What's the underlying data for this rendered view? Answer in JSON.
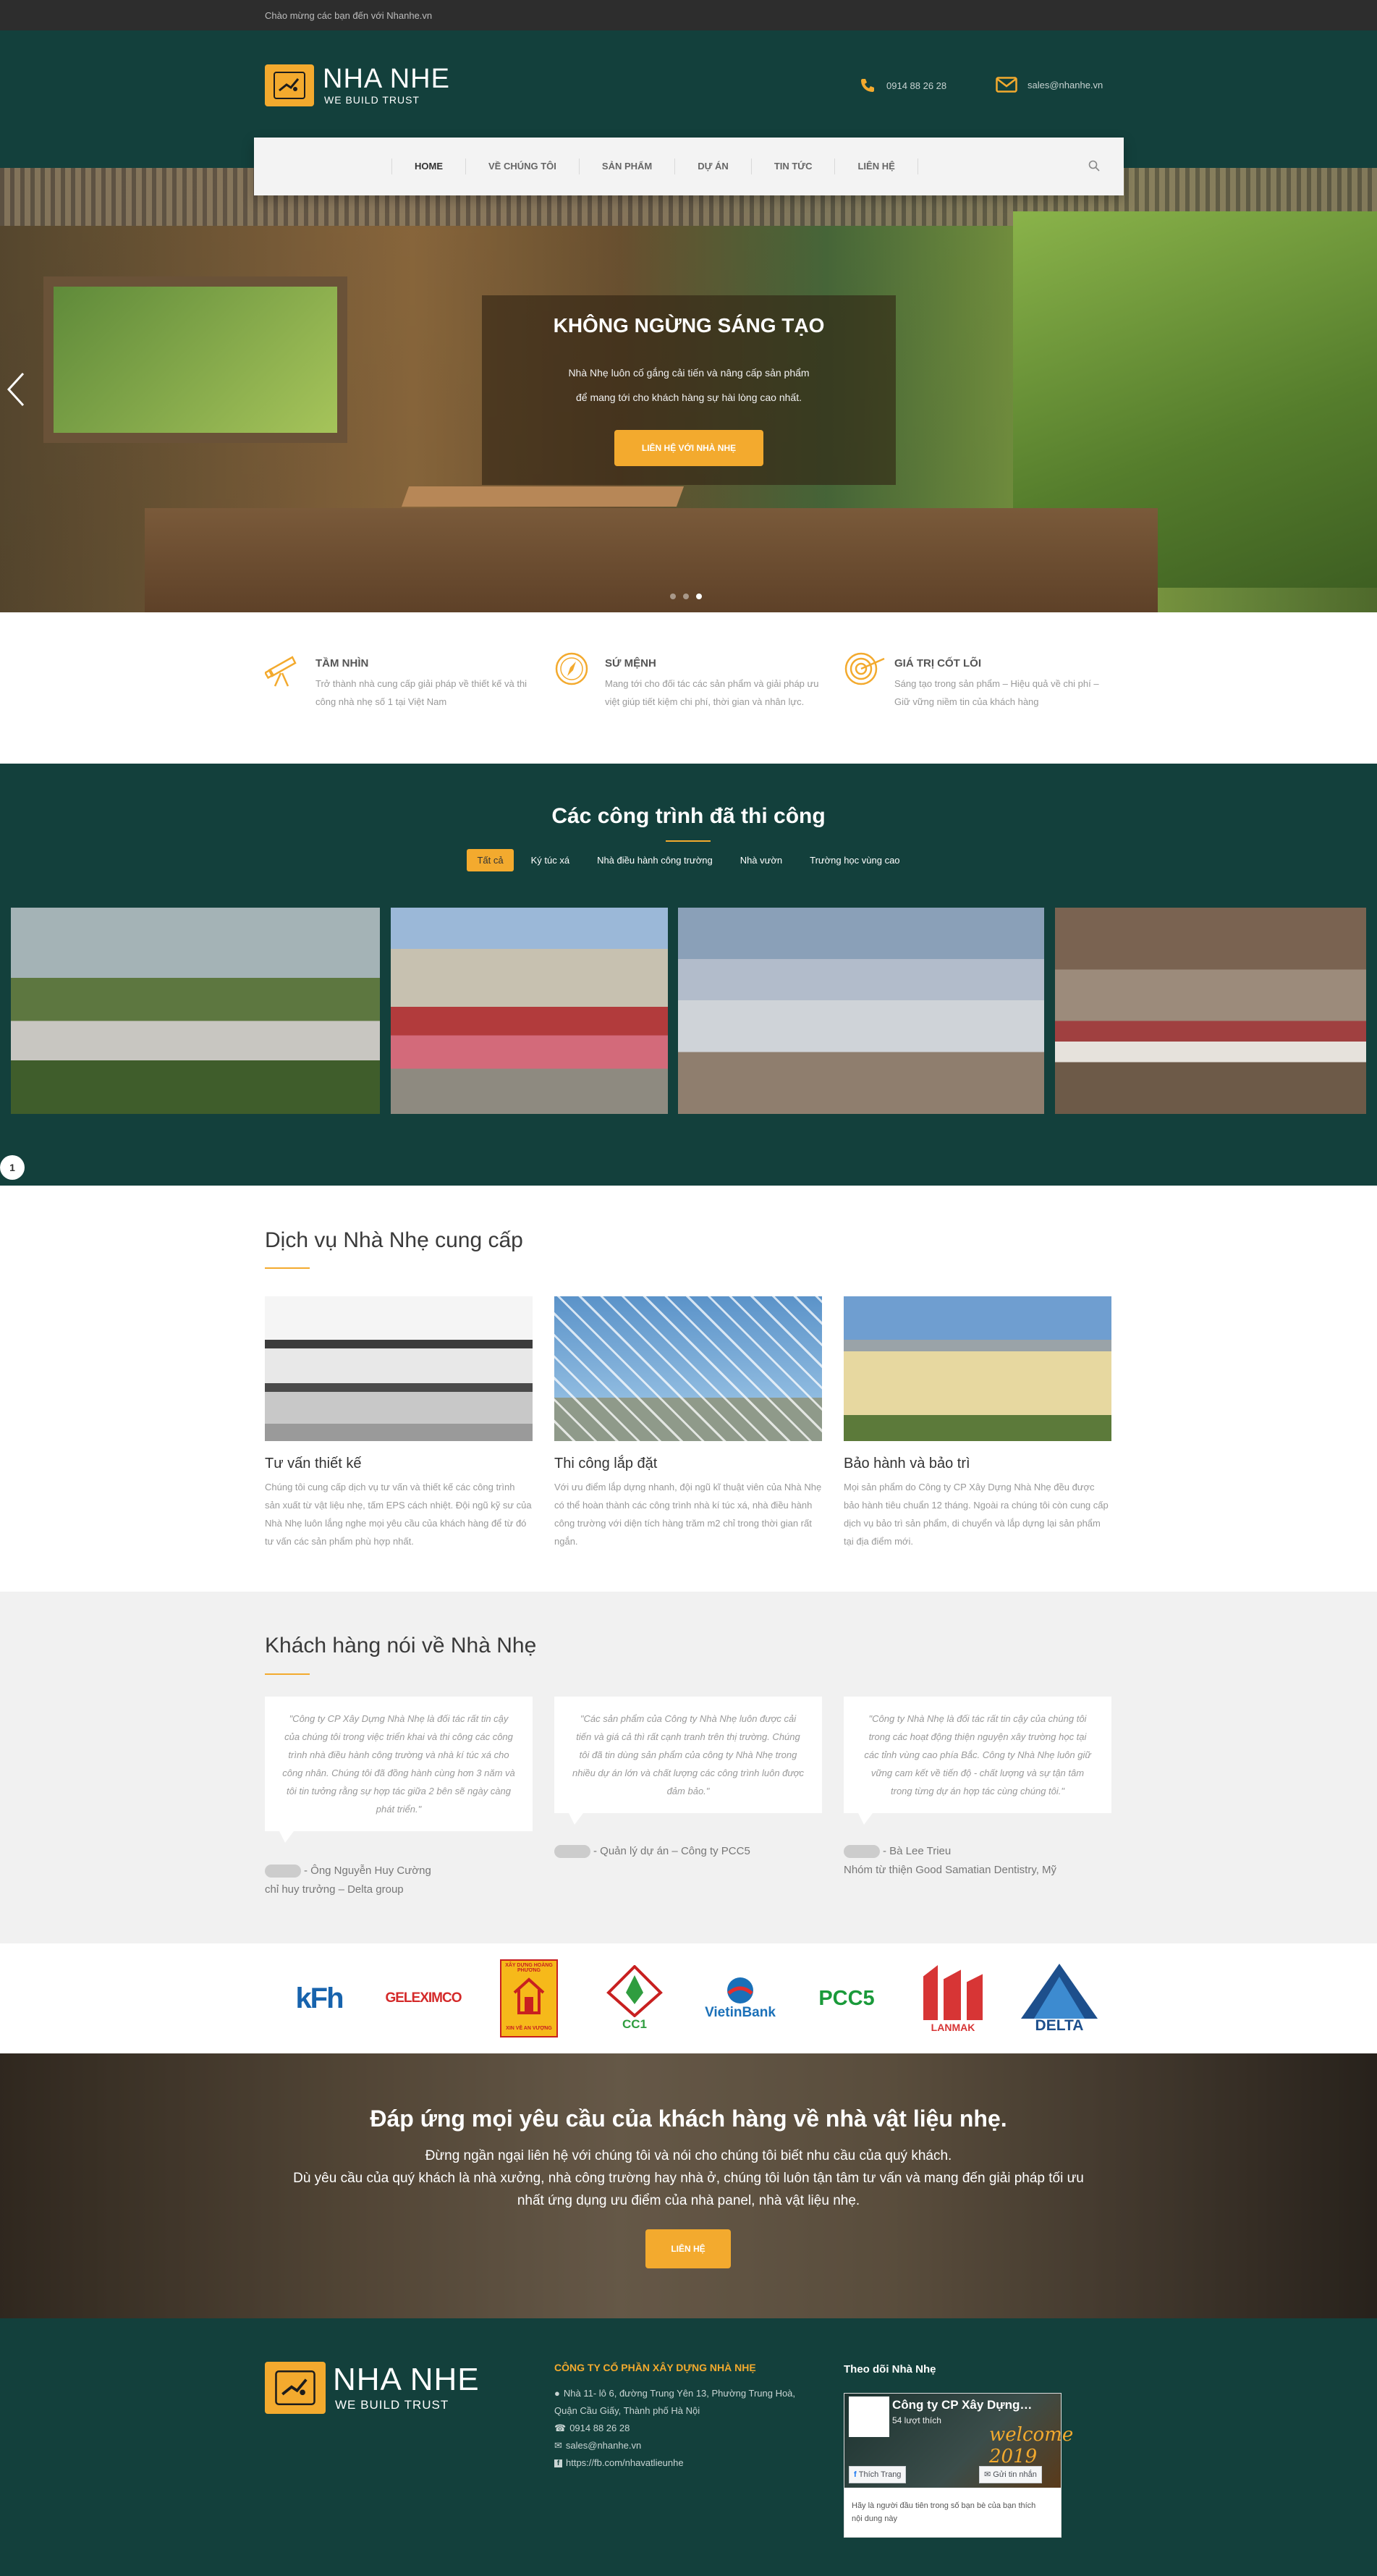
{
  "topbar": {
    "welcome": "Chào mừng các bạn đến với Nhanhe.vn"
  },
  "brand": {
    "name": "NHA NHE",
    "tagline": "WE BUILD TRUST",
    "accent": "#f3aa2e",
    "dark": "#13403c"
  },
  "contact": {
    "phone": "0914 88 26 28",
    "email": "sales@nhanhe.vn"
  },
  "nav": {
    "items": [
      "HOME",
      "VỀ CHÚNG TÔI",
      "SẢN PHẨM",
      "DỰ ÁN",
      "TIN TỨC",
      "LIÊN HỆ"
    ]
  },
  "hero": {
    "title": "KHÔNG NGỪNG SÁNG TẠO",
    "line1": "Nhà Nhẹ luôn cố gắng cải tiến và nâng cấp sản phẩm",
    "line2": "để mang tới cho khách hàng sự hài lòng cao nhất.",
    "button": "LIÊN HỆ VỚI NHÀ NHẸ"
  },
  "features": [
    {
      "title": "TẦM NHÌN",
      "text": "Trở thành nhà cung cấp giải pháp về thiết kế và thi công nhà nhẹ số 1 tại Việt Nam"
    },
    {
      "title": "SỨ MỆNH",
      "text": "Mang tới cho đối tác các sản phẩm và giải pháp ưu việt giúp tiết kiệm chi phí, thời gian và nhân lực."
    },
    {
      "title": "GIÁ TRỊ CỐT LÕI",
      "text": "Sáng tạo trong sản phẩm – Hiệu quả về chi phí – Giữ vững niềm tin của khách hàng"
    }
  ],
  "projects": {
    "title": "Các công trình đã thi công",
    "filters": [
      "Tất cả",
      "Ký túc xá",
      "Nhà điều hành công trường",
      "Nhà vườn",
      "Trường học vùng cao"
    ],
    "page": "1"
  },
  "services": {
    "title": "Dịch vụ Nhà Nhẹ cung cấp",
    "items": [
      {
        "title": "Tư vấn thiết kế",
        "text": "Chúng tôi cung cấp dịch vụ tư vấn và thiết kế các công trình sản xuất từ vật liệu nhẹ, tấm EPS cách nhiệt. Đội ngũ kỹ sư của Nhà Nhẹ luôn lắng nghe mọi yêu cầu của khách hàng để từ đó tư vấn các sản phẩm phù hợp nhất."
      },
      {
        "title": "Thi công lắp đặt",
        "text": "Với ưu điểm lắp dựng nhanh, đội ngũ kĩ thuật viên của Nhà Nhẹ có thể hoàn thành các công trình nhà kí túc xá, nhà điều hành công trường với diện tích hàng trăm m2 chỉ trong thời gian rất ngắn."
      },
      {
        "title": "Bảo hành và bảo trì",
        "text": "Mọi sản phẩm do Công ty CP Xây Dựng Nhà Nhẹ đều được bảo hành tiêu chuẩn 12 tháng. Ngoài ra chúng tôi còn cung cấp dịch vụ bảo trì sản phẩm, di chuyển và lắp dựng lại sản phẩm tại địa điểm mới."
      }
    ]
  },
  "testimonials": {
    "title": "Khách hàng nói về Nhà Nhẹ",
    "items": [
      {
        "quote": "\"Công ty CP Xây Dựng Nhà Nhẹ là đối tác rất tin cậy của chúng tôi trong việc triển khai và thi công các công trình nhà điều hành công trường và nhà kí túc xá cho công nhân. Chúng tôi đã đồng hành cùng hơn 3 năm và tôi tin tưởng rằng sự hợp tác giữa 2 bên sẽ ngày càng phát triển.\"",
        "author1": "- Ông Nguyễn Huy Cường",
        "author2": "chỉ huy trưởng – Delta group"
      },
      {
        "quote": "\"Các sản phẩm của Công ty Nhà Nhẹ luôn được cải tiến và giá cả thì rất cạnh tranh trên thị trường. Chúng tôi đã tin dùng sản phẩm của công ty Nhà Nhẹ trong nhiều dự án lớn và chất lượng các công trình luôn được đảm bảo.\"",
        "author1": "- Quản lý dự án – Công ty PCC5",
        "author2": ""
      },
      {
        "quote": "\"Công ty Nhà Nhẹ là đối tác rất tin cậy của chúng tôi trong các hoạt động thiện nguyện xây trường học tại các tỉnh vùng cao phía Bắc. Công ty Nhà Nhẹ luôn giữ vững cam kết về tiến độ - chất lượng và sự tận tâm trong từng dự án hợp tác cùng chúng tôi.\"",
        "author1": "- Bà Lee Trieu",
        "author2": "Nhóm từ thiện Good Samatian Dentistry, Mỹ"
      }
    ]
  },
  "partners": {
    "kfh": "kFh",
    "geleximco": "GELEXIMCO",
    "hoangphuong_top": "XÂY DỰNG HOÀNG PHƯƠNG",
    "hoangphuong_bottom": "XIN VỀ AN VƯỢNG",
    "cc1": "CC1",
    "vietinbank": "VietinBank",
    "pcc5": "PCC5",
    "lanmak": "LANMAK",
    "delta": "DELTA"
  },
  "cta": {
    "title": "Đáp ứng mọi yêu cầu của khách hàng về nhà vật liệu nhẹ.",
    "line1": "Đừng ngần ngại liên hệ với chúng tôi và nói cho chúng tôi biết nhu cầu của quý khách.",
    "line2": "Dù yêu cầu của quý khách là nhà xưởng, nhà công trường hay nhà ở, chúng tôi luôn tận tâm tư vấn và mang đến giải pháp tối ưu",
    "line3": "nhất ứng dụng ưu điểm của nhà panel, nhà vật liệu nhẹ.",
    "button": "LIÊN HỆ"
  },
  "footer": {
    "company": "CÔNG TY CỔ PHẦN XÂY DỰNG NHÀ NHẸ",
    "address1": "Nhà 11- lô 6, đường Trung Yên 13, Phường Trung Hoà,",
    "address2": "Quận Cầu Giấy, Thành phố Hà Nội",
    "phone": "0914 88 26 28",
    "email": "sales@nhanhe.vn",
    "facebook": "https://fb.com/nhavatlieunhe",
    "follow_title": "Theo dõi Nhà Nhẹ",
    "fb_page": "Công ty CP Xây Dựng…",
    "fb_likes": "54 lượt thích",
    "fb_cover_text": "welcome 2019",
    "fb_like_btn": "Thích Trang",
    "fb_msg_btn": "Gửi tin nhắn",
    "fb_note": "Hãy là người đầu tiên trong số bạn bè của bạn thích nội dung này"
  }
}
